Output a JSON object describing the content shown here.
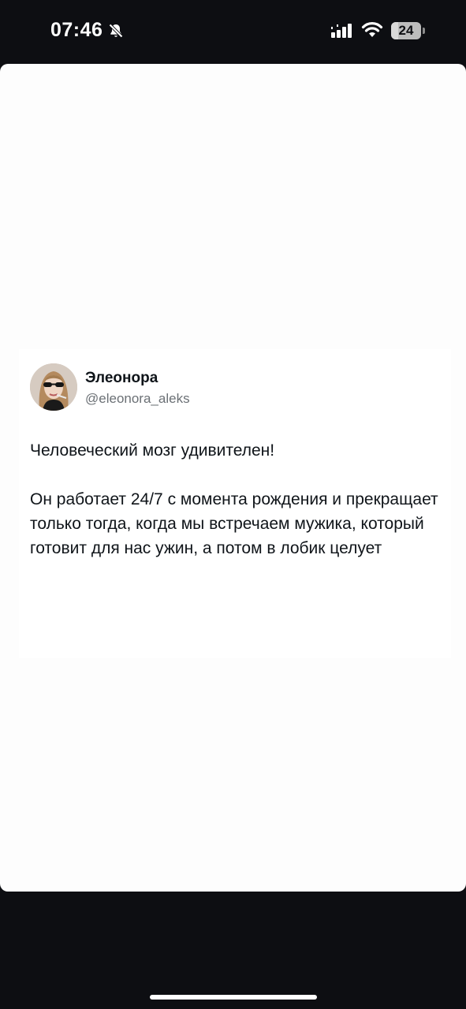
{
  "status_bar": {
    "time": "07:46",
    "battery_level": "24",
    "battery_fraction": 0.24,
    "icons": [
      "bell-muted-icon",
      "signal-icon",
      "wifi-icon",
      "battery-icon"
    ]
  },
  "tweet": {
    "display_name": "Элеонора",
    "handle": "@eleonora_aleks",
    "paragraphs": [
      "Человеческий мозг удивителен!",
      "Он работает 24/7 с момента рождения и прекращает только тогда, когда мы встречаем мужика, который готовит для нас ужин, а потом в лобик целует"
    ]
  },
  "colors": {
    "background": "#0d0e12",
    "sheet": "#fdfdfd",
    "text_primary": "#0f1419",
    "text_secondary": "#6b7075"
  }
}
